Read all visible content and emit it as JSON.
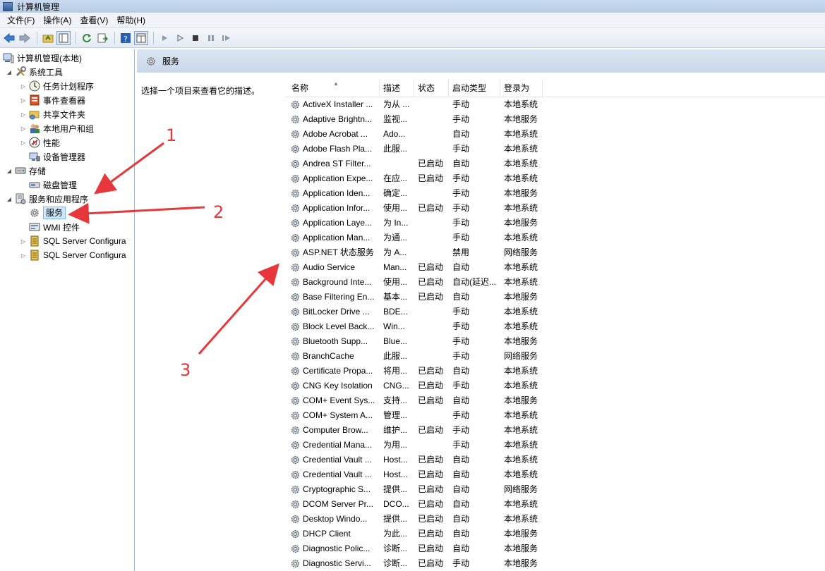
{
  "window": {
    "title": "计算机管理"
  },
  "menu": [
    "文件(F)",
    "操作(A)",
    "查看(V)",
    "帮助(H)"
  ],
  "toolbar": {
    "icons": [
      "back-icon",
      "forward-icon",
      "up-folder-icon",
      "show-hide-tree-icon",
      "refresh-icon",
      "export-list-icon",
      "help-icon",
      "properties-icon",
      "play-icon",
      "play-alt-icon",
      "stop-icon",
      "pause-icon",
      "restart-icon"
    ]
  },
  "tree": {
    "root": "计算机管理(本地)",
    "system_tools": "系统工具",
    "task_scheduler": "任务计划程序",
    "event_viewer": "事件查看器",
    "shared_folders": "共享文件夹",
    "local_users": "本地用户和组",
    "performance": "性能",
    "device_manager": "设备管理器",
    "storage": "存储",
    "disk_management": "磁盘管理",
    "services_apps": "服务和应用程序",
    "services": "服务",
    "wmi": "WMI 控件",
    "sql1": "SQL Server Configura",
    "sql2": "SQL Server Configura"
  },
  "panel": {
    "title": "服务",
    "description": "选择一个项目来查看它的描述。"
  },
  "columns": {
    "name": "名称",
    "desc": "描述",
    "status": "状态",
    "startup": "启动类型",
    "logon": "登录为"
  },
  "services": [
    {
      "name": "ActiveX Installer ...",
      "desc": "为从 ...",
      "status": "",
      "startup": "手动",
      "logon": "本地系统"
    },
    {
      "name": "Adaptive Brightn...",
      "desc": "监视...",
      "status": "",
      "startup": "手动",
      "logon": "本地服务"
    },
    {
      "name": "Adobe Acrobat ...",
      "desc": "Ado...",
      "status": "",
      "startup": "自动",
      "logon": "本地系统"
    },
    {
      "name": "Adobe Flash Pla...",
      "desc": "此服...",
      "status": "",
      "startup": "手动",
      "logon": "本地系统"
    },
    {
      "name": "Andrea ST Filter...",
      "desc": "",
      "status": "已启动",
      "startup": "自动",
      "logon": "本地系统"
    },
    {
      "name": "Application Expe...",
      "desc": "在应...",
      "status": "已启动",
      "startup": "手动",
      "logon": "本地系统"
    },
    {
      "name": "Application Iden...",
      "desc": "确定...",
      "status": "",
      "startup": "手动",
      "logon": "本地服务"
    },
    {
      "name": "Application Infor...",
      "desc": "使用...",
      "status": "已启动",
      "startup": "手动",
      "logon": "本地系统"
    },
    {
      "name": "Application Laye...",
      "desc": "为 In...",
      "status": "",
      "startup": "手动",
      "logon": "本地服务"
    },
    {
      "name": "Application Man...",
      "desc": "为通...",
      "status": "",
      "startup": "手动",
      "logon": "本地系统"
    },
    {
      "name": "ASP.NET 状态服务",
      "desc": "为 A...",
      "status": "",
      "startup": "禁用",
      "logon": "网络服务"
    },
    {
      "name": "Audio Service",
      "desc": "Man...",
      "status": "已启动",
      "startup": "自动",
      "logon": "本地系统"
    },
    {
      "name": "Background Inte...",
      "desc": "使用...",
      "status": "已启动",
      "startup": "自动(延迟...",
      "logon": "本地系统"
    },
    {
      "name": "Base Filtering En...",
      "desc": "基本...",
      "status": "已启动",
      "startup": "自动",
      "logon": "本地服务"
    },
    {
      "name": "BitLocker Drive ...",
      "desc": "BDE...",
      "status": "",
      "startup": "手动",
      "logon": "本地系统"
    },
    {
      "name": "Block Level Back...",
      "desc": "Win...",
      "status": "",
      "startup": "手动",
      "logon": "本地系统"
    },
    {
      "name": "Bluetooth Supp...",
      "desc": "Blue...",
      "status": "",
      "startup": "手动",
      "logon": "本地服务"
    },
    {
      "name": "BranchCache",
      "desc": "此服...",
      "status": "",
      "startup": "手动",
      "logon": "网络服务"
    },
    {
      "name": "Certificate Propa...",
      "desc": "将用...",
      "status": "已启动",
      "startup": "自动",
      "logon": "本地系统"
    },
    {
      "name": "CNG Key Isolation",
      "desc": "CNG...",
      "status": "已启动",
      "startup": "手动",
      "logon": "本地系统"
    },
    {
      "name": "COM+ Event Sys...",
      "desc": "支持...",
      "status": "已启动",
      "startup": "自动",
      "logon": "本地服务"
    },
    {
      "name": "COM+ System A...",
      "desc": "管理...",
      "status": "",
      "startup": "手动",
      "logon": "本地系统"
    },
    {
      "name": "Computer Brow...",
      "desc": "维护...",
      "status": "已启动",
      "startup": "手动",
      "logon": "本地系统"
    },
    {
      "name": "Credential Mana...",
      "desc": "为用...",
      "status": "",
      "startup": "手动",
      "logon": "本地系统"
    },
    {
      "name": "Credential Vault ...",
      "desc": "Host...",
      "status": "已启动",
      "startup": "自动",
      "logon": "本地系统"
    },
    {
      "name": "Credential Vault ...",
      "desc": "Host...",
      "status": "已启动",
      "startup": "自动",
      "logon": "本地系统"
    },
    {
      "name": "Cryptographic S...",
      "desc": "提供...",
      "status": "已启动",
      "startup": "自动",
      "logon": "网络服务"
    },
    {
      "name": "DCOM Server Pr...",
      "desc": "DCO...",
      "status": "已启动",
      "startup": "自动",
      "logon": "本地系统"
    },
    {
      "name": "Desktop Windo...",
      "desc": "提供...",
      "status": "已启动",
      "startup": "自动",
      "logon": "本地系统"
    },
    {
      "name": "DHCP Client",
      "desc": "为此...",
      "status": "已启动",
      "startup": "自动",
      "logon": "本地服务"
    },
    {
      "name": "Diagnostic Polic...",
      "desc": "诊断...",
      "status": "已启动",
      "startup": "自动",
      "logon": "本地服务"
    },
    {
      "name": "Diagnostic Servi...",
      "desc": "诊断...",
      "status": "已启动",
      "startup": "手动",
      "logon": "本地服务"
    }
  ],
  "annotations": {
    "n1": "1",
    "n2": "2",
    "n3": "3",
    "color": "#e8373a"
  }
}
